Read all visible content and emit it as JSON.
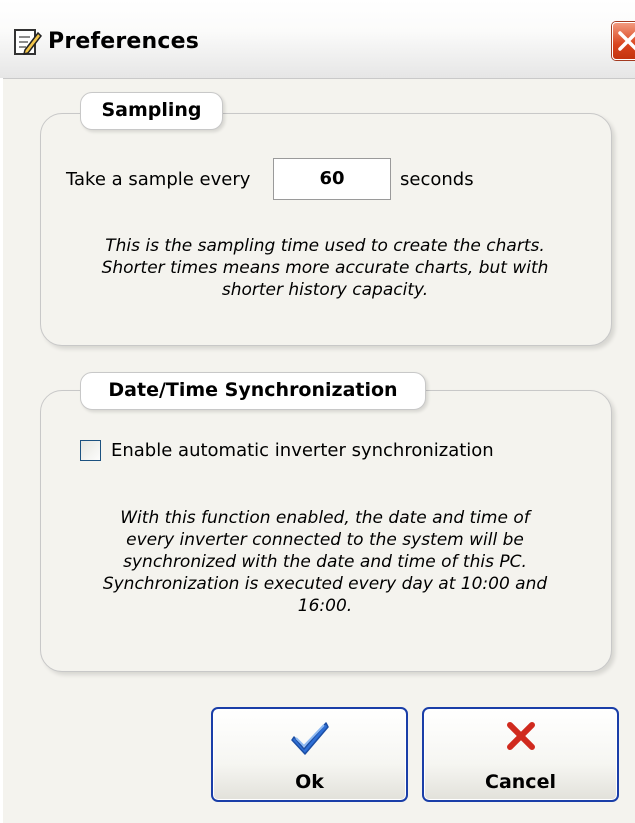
{
  "window": {
    "title": "Preferences"
  },
  "sampling": {
    "group_title": "Sampling",
    "prefix_label": "Take a sample every",
    "value": "60",
    "suffix_label": "seconds",
    "note": "This is the sampling time used to create the charts.\nShorter times means more accurate charts, but with\nshorter history capacity."
  },
  "sync": {
    "group_title": "Date/Time Synchronization",
    "checkbox_label": "Enable automatic inverter synchronization",
    "checked": false,
    "note": "With this function enabled, the date and time of\nevery inverter connected to the system will be\nsynchronized with the date and time of this PC.\nSynchronization is executed every day at 10:00 and\n16:00."
  },
  "buttons": {
    "ok_label": "Ok",
    "cancel_label": "Cancel"
  },
  "icons": {
    "title_icon": "edit-document-icon",
    "close_icon": "close-icon",
    "ok_icon": "checkmark-icon",
    "cancel_icon": "red-x-icon"
  },
  "colors": {
    "checkmark": "#2e6fd6",
    "cancel_x": "#d02a1e",
    "button_border": "#1a3ea8"
  }
}
